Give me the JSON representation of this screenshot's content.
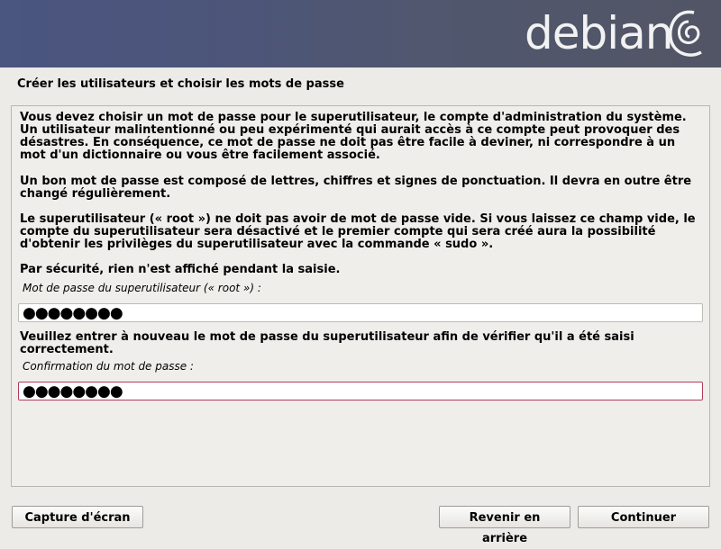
{
  "banner": {
    "wordmark": "debian",
    "logo_icon": "debian-swirl-icon"
  },
  "page_title": "Créer les utilisateurs et choisir les mots de passe",
  "paragraphs": [
    "Vous devez choisir un mot de passe pour le superutilisateur, le compte d'administration du système. Un utilisateur malintentionné ou peu expérimenté qui aurait accès à ce compte peut provoquer des désastres. En conséquence, ce mot de passe ne doit pas être facile à deviner, ni correspondre à un mot d'un dictionnaire ou vous être facilement associé.",
    "Un bon mot de passe est composé de lettres, chiffres et signes de ponctuation. Il devra en outre être changé régulièrement.",
    "Le superutilisateur (« root ») ne doit pas avoir de mot de passe vide. Si vous laissez ce champ vide, le compte du superutilisateur sera désactivé et le premier compte qui sera créé aura la possibilité d'obtenir les privilèges du superutilisateur avec la commande « sudo ».",
    "Par sécurité, rien n'est affiché pendant la saisie."
  ],
  "root_password": {
    "label": "Mot de passe du superutilisateur (« root ») :",
    "value": "●●●●●●●●"
  },
  "confirm_text": "Veuillez entrer à nouveau le mot de passe du superutilisateur afin de vérifier qu'il a été saisi correctement.",
  "confirm_password": {
    "label": "Confirmation du mot de passe :",
    "value": "●●●●●●●●"
  },
  "buttons": {
    "screenshot": "Capture d'écran",
    "back": "Revenir en arrière",
    "continue": "Continuer"
  },
  "colors": {
    "banner": "#4d5578",
    "background": "#ecebe8",
    "focus_border": "#b03a5a"
  }
}
